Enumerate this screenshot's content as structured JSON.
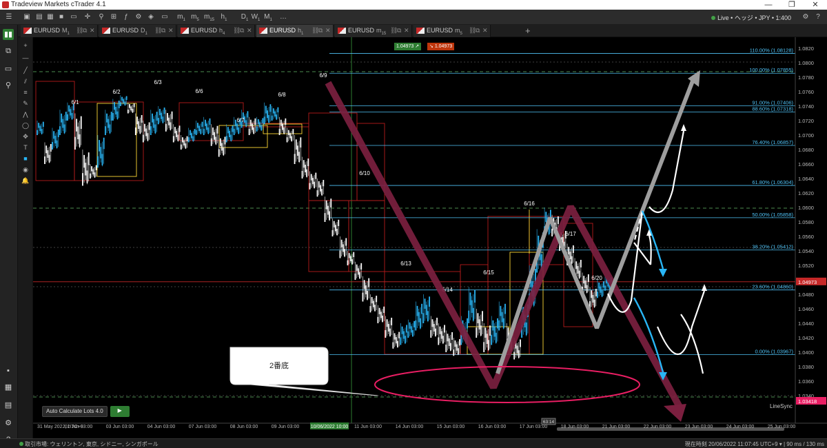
{
  "window": {
    "title": "Tradeview Markets cTrader 4.1",
    "min": "—",
    "max": "❐",
    "close": "✕"
  },
  "account": {
    "text": "Live • ヘッジ • JPY • 1:400"
  },
  "toolbar": {
    "timeframes": [
      "m",
      "m",
      "m",
      "h",
      "D",
      "W",
      "M"
    ],
    "timeframe_subs": [
      "1",
      "5",
      "15",
      "1",
      "1",
      "1",
      "1"
    ]
  },
  "tabs": [
    {
      "symbol": "EURUSD",
      "tf": "M",
      "sub": "1",
      "active": false
    },
    {
      "symbol": "EURUSD",
      "tf": "D",
      "sub": "1",
      "active": false
    },
    {
      "symbol": "EURUSD",
      "tf": "h",
      "sub": "4",
      "active": false
    },
    {
      "symbol": "EURUSD",
      "tf": "h",
      "sub": "1",
      "active": true
    },
    {
      "symbol": "EURUSD",
      "tf": "m",
      "sub": "15",
      "active": false
    },
    {
      "symbol": "EURUSD",
      "tf": "m",
      "sub": "5",
      "active": false
    }
  ],
  "quotes": {
    "buy": "1.04973",
    "sell": "1.04973"
  },
  "chart_data": {
    "type": "candlestick",
    "symbol": "EURUSD",
    "timeframe": "h1",
    "price_axis": [
      "1.0820",
      "1.0800",
      "1.0780",
      "1.0760",
      "1.0740",
      "1.0720",
      "1.0700",
      "1.0680",
      "1.0660",
      "1.0640",
      "1.0620",
      "1.0600",
      "1.0580",
      "1.0560",
      "1.0540",
      "1.0520",
      "1.0500",
      "1.0480",
      "1.0460",
      "1.0440",
      "1.0420",
      "1.0400",
      "1.0380",
      "1.0360",
      "1.0340"
    ],
    "current_price": "1.04973",
    "marker_price": "1.03418",
    "time_axis": [
      "31 May 2022, UTC+9",
      "02 Jun 03:00",
      "03 Jun 03:00",
      "04 Jun 03:00",
      "07 Jun 03:00",
      "08 Jun 03:00",
      "09 Jun 03:00",
      "10/06/2022 10:00",
      "11 Jun 03:00",
      "14 Jun 03:00",
      "15 Jun 03:00",
      "16 Jun 03:00",
      "17 Jun 03:00",
      "18 Jun 03:00",
      "21 Jun 03:00",
      "22 Jun 03:00",
      "23 Jun 03:00",
      "24 Jun 03:00",
      "25 Jun 03:00"
    ],
    "fibonacci": [
      {
        "level": "110.00%",
        "price": "1.08128"
      },
      {
        "level": "100.00%",
        "price": "1.07855"
      },
      {
        "level": "91.00%",
        "price": "1.07406"
      },
      {
        "level": "88.60%",
        "price": "1.07318"
      },
      {
        "level": "76.40%",
        "price": "1.06857"
      },
      {
        "level": "61.80%",
        "price": "1.06304"
      },
      {
        "level": "50.00%",
        "price": "1.05858"
      },
      {
        "level": "38.20%",
        "price": "1.05412"
      },
      {
        "level": "23.60%",
        "price": "1.04860"
      },
      {
        "level": "0.00%",
        "price": "1.03967"
      }
    ],
    "day_labels": [
      "6/1",
      "6/2",
      "6/3",
      "6/6",
      "6/7",
      "6/8",
      "6/9",
      "6/10",
      "6/13",
      "6/14",
      "6/15",
      "6/16",
      "6/17",
      "6/20"
    ],
    "annotation": "2番底",
    "indicator": "LineSync",
    "colors": {
      "bull": "#29b6f6",
      "bear": "#ffffff",
      "fib": "#4fc3f7",
      "red_box": "#b71c1c",
      "yellow_box": "#fdd835",
      "pink": "#e91e63",
      "maroon": "#7b1f3f"
    }
  },
  "autocalc": {
    "label": "Auto Calculate Lots 4.0",
    "play": "▶"
  },
  "status": {
    "left": "取引市場: ウェリントン, 東京, シドニー, シンガポール",
    "right": "現在時刻 20/06/2022 11:07:45   UTC+9 ▾   | 90 ms / 130 ms"
  },
  "badge_center": "63:14"
}
